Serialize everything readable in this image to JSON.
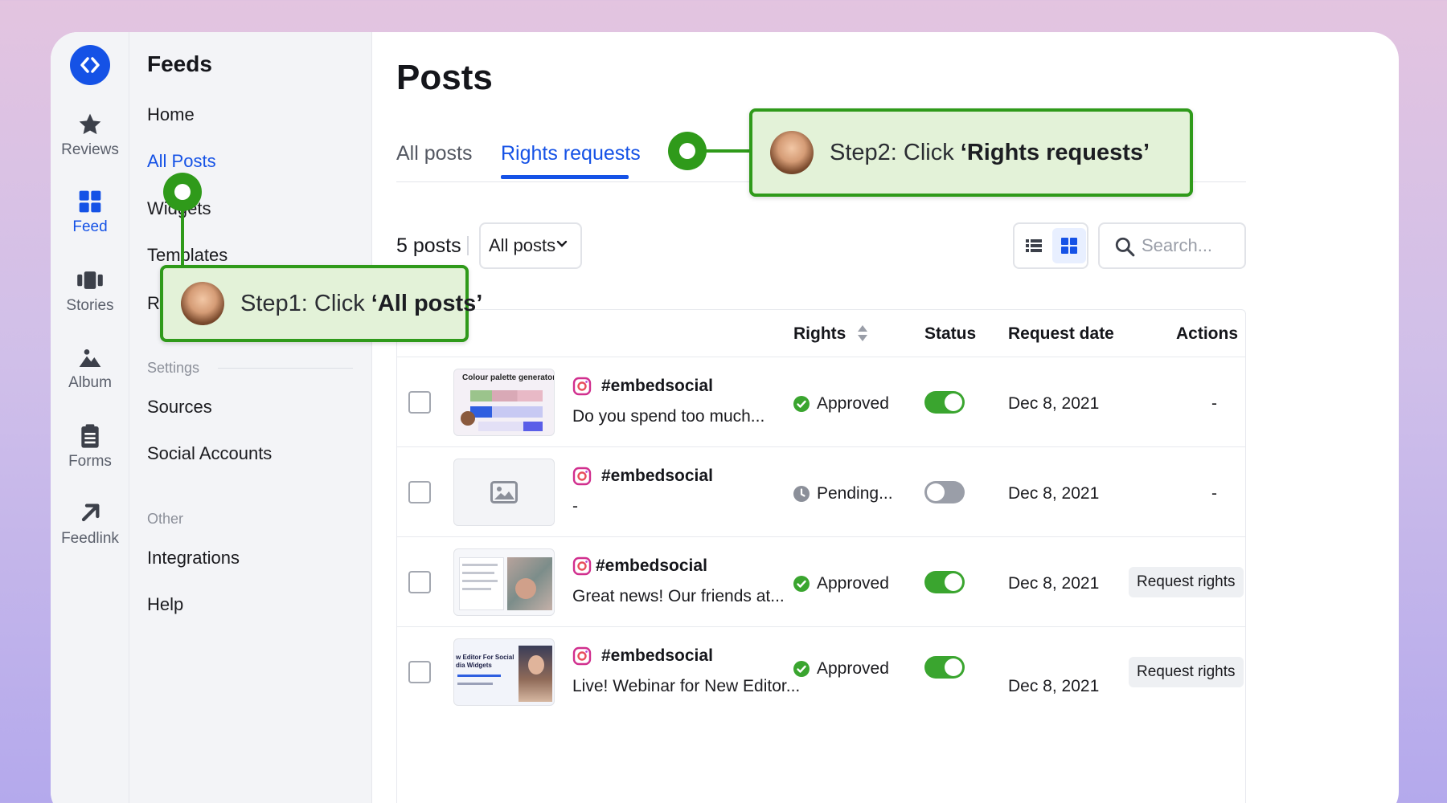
{
  "rail": {
    "items": [
      {
        "label": "Reviews",
        "icon": "star-icon"
      },
      {
        "label": "Feed",
        "icon": "grid-icon"
      },
      {
        "label": "Stories",
        "icon": "stories-icon"
      },
      {
        "label": "Album",
        "icon": "image-icon"
      },
      {
        "label": "Forms",
        "icon": "clipboard-icon"
      },
      {
        "label": "Feedlink",
        "icon": "arrow-up-right-icon"
      }
    ],
    "active": "Feed"
  },
  "nav": {
    "title": "Feeds",
    "items": [
      "Home",
      "All Posts",
      "Widgets",
      "Templates",
      "R"
    ],
    "active": "All Posts",
    "settings_label": "Settings",
    "settings_items": [
      "Sources",
      "Social Accounts"
    ],
    "other_label": "Other",
    "other_items": [
      "Integrations",
      "Help"
    ]
  },
  "main": {
    "title": "Posts",
    "tabs": [
      {
        "label": "All posts",
        "active": false
      },
      {
        "label": "Rights requests",
        "active": true
      }
    ],
    "posts_count": "5 posts",
    "filter_value": "All posts",
    "search_placeholder": "Search..."
  },
  "table": {
    "headers": {
      "rights": "Rights",
      "status": "Status",
      "request_date": "Request date",
      "actions": "Actions"
    },
    "rows": [
      {
        "handle": "#embedsocial",
        "caption": "Do you spend too much...",
        "rights": "Approved",
        "status_on": true,
        "date": "Dec 8, 2021",
        "action": "-",
        "thumb_title": "Colour palette generator"
      },
      {
        "handle": "#embedsocial",
        "caption": "-",
        "rights": "Pending...",
        "status_on": false,
        "date": "Dec 8, 2021",
        "action": "-"
      },
      {
        "handle": "#embedsocial",
        "caption": "Great news! Our friends at...",
        "rights": "Approved",
        "status_on": true,
        "date": "Dec 8, 2021",
        "action": "Request rights"
      },
      {
        "handle": "#embedsocial",
        "caption": "Live! Webinar for New Editor...",
        "rights": "Approved",
        "status_on": true,
        "date": "Dec 8, 2021",
        "action": "Request rights",
        "thumb_title": "w Editor For Social\ndia Widgets"
      }
    ]
  },
  "callouts": {
    "step1_prefix": "Step1: Click ",
    "step1_bold": "‘All posts’",
    "step2_prefix": "Step2: Click ",
    "step2_bold": "‘Rights requests’"
  },
  "colors": {
    "accent": "#1552e6",
    "callout_green": "#2f9a1a",
    "callout_bg": "#e3f2d8",
    "approved_green": "#3aa52f"
  }
}
